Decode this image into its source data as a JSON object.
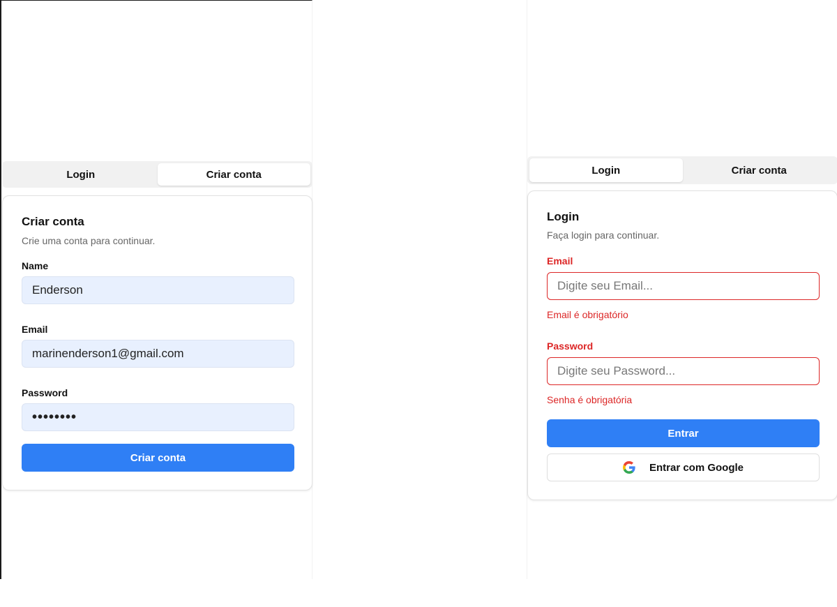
{
  "signup_screen": {
    "tabs": {
      "login": "Login",
      "signup": "Criar conta",
      "active": "signup"
    },
    "card": {
      "title": "Criar conta",
      "subtitle": "Crie uma conta para continuar.",
      "name_label": "Name",
      "name_value": "Enderson",
      "email_label": "Email",
      "email_value": "marinenderson1@gmail.com",
      "password_label": "Password",
      "password_value": "••••••••",
      "submit_label": "Criar conta"
    }
  },
  "login_screen": {
    "tabs": {
      "login": "Login",
      "signup": "Criar conta",
      "active": "login"
    },
    "card": {
      "title": "Login",
      "subtitle": "Faça login para continuar.",
      "email_label": "Email",
      "email_placeholder": "Digite seu Email...",
      "email_error": "Email é obrigatório",
      "password_label": "Password",
      "password_placeholder": "Digite seu Password...",
      "password_error": "Senha é obrigatória",
      "submit_label": "Entrar",
      "google_label": "Entrar com Google"
    }
  },
  "colors": {
    "primary": "#2f7ff5",
    "error": "#dc2626",
    "autofill": "#e8f0fe",
    "tab_bg": "#f1f1f1"
  },
  "icons": {
    "google": "google-icon"
  }
}
